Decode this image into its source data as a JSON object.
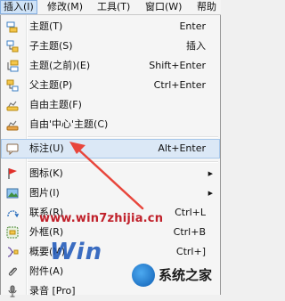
{
  "menubar": {
    "items": [
      "插入(I)",
      "修改(M)",
      "工具(T)",
      "窗口(W)",
      "帮助"
    ]
  },
  "menu": {
    "items": [
      {
        "label": "主题(T)",
        "shortcut": "Enter",
        "icon": "topic-icon"
      },
      {
        "label": "子主题(S)",
        "shortcut": "插入",
        "icon": "subtopic-icon"
      },
      {
        "label": "主题(之前)(E)",
        "shortcut": "Shift+Enter",
        "icon": "topic-before-icon"
      },
      {
        "label": "父主题(P)",
        "shortcut": "Ctrl+Enter",
        "icon": "parent-topic-icon"
      },
      {
        "label": "自由主题(F)",
        "shortcut": "",
        "icon": "floating-topic-icon"
      },
      {
        "label": "自由'中心'主题(C)",
        "shortcut": "",
        "icon": "floating-center-topic-icon"
      },
      {
        "label": "标注(U)",
        "shortcut": "Alt+Enter",
        "icon": "callout-icon"
      },
      {
        "label": "图标(K)",
        "shortcut": "",
        "icon": "flag-icon"
      },
      {
        "label": "图片(I)",
        "shortcut": "",
        "icon": "image-icon"
      },
      {
        "label": "联系(R)",
        "shortcut": "Ctrl+L",
        "icon": "relationship-icon"
      },
      {
        "label": "外框(R)",
        "shortcut": "Ctrl+B",
        "icon": "boundary-icon"
      },
      {
        "label": "概要(M)",
        "shortcut": "Ctrl+]",
        "icon": "summary-icon"
      },
      {
        "label": "附件(A)",
        "shortcut": "",
        "icon": "attachment-icon"
      },
      {
        "label": "录音 [Pro]",
        "shortcut": "",
        "icon": "record-icon"
      }
    ]
  },
  "watermark": {
    "site": "www.win7zhijia.cn",
    "brand_text": "系统之家",
    "brand_letters": "Win"
  },
  "colors": {
    "highlight": "#dbe8f6",
    "arrow": "#e8463c",
    "watermark_red": "#c0202a"
  }
}
